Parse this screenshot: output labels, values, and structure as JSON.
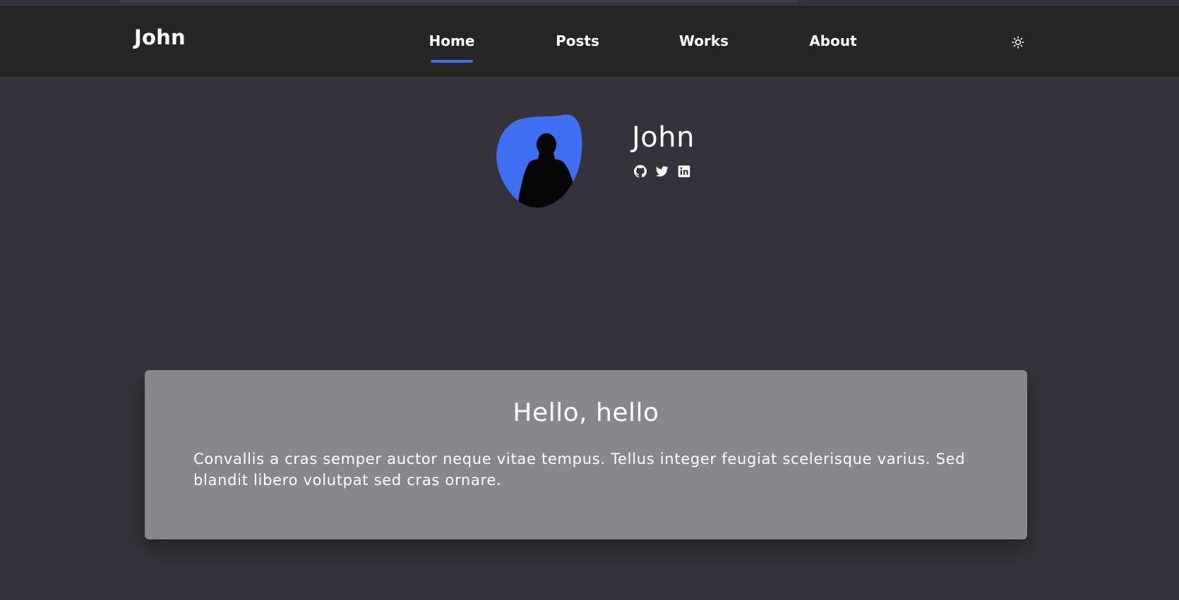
{
  "header": {
    "logo": "John",
    "nav": [
      {
        "label": "Home",
        "active": true
      },
      {
        "label": "Posts",
        "active": false
      },
      {
        "label": "Works",
        "active": false
      },
      {
        "label": "About",
        "active": false
      }
    ],
    "theme_toggle_icon": "sun-icon"
  },
  "profile": {
    "name": "John",
    "avatar_icon": "person-silhouette",
    "social": [
      "github-icon",
      "twitter-icon",
      "linkedin-icon"
    ]
  },
  "card": {
    "title": "Hello, hello",
    "body": "Convallis a cras semper auctor neque vitae tempus. Tellus integer feugiat scelerisque varius. Sed blandit libero volutpat sed cras ornare."
  },
  "colors": {
    "accent": "#3f6ef0",
    "header_bg": "#252525",
    "page_bg": "#34333b",
    "card_bg": "#88878d"
  }
}
